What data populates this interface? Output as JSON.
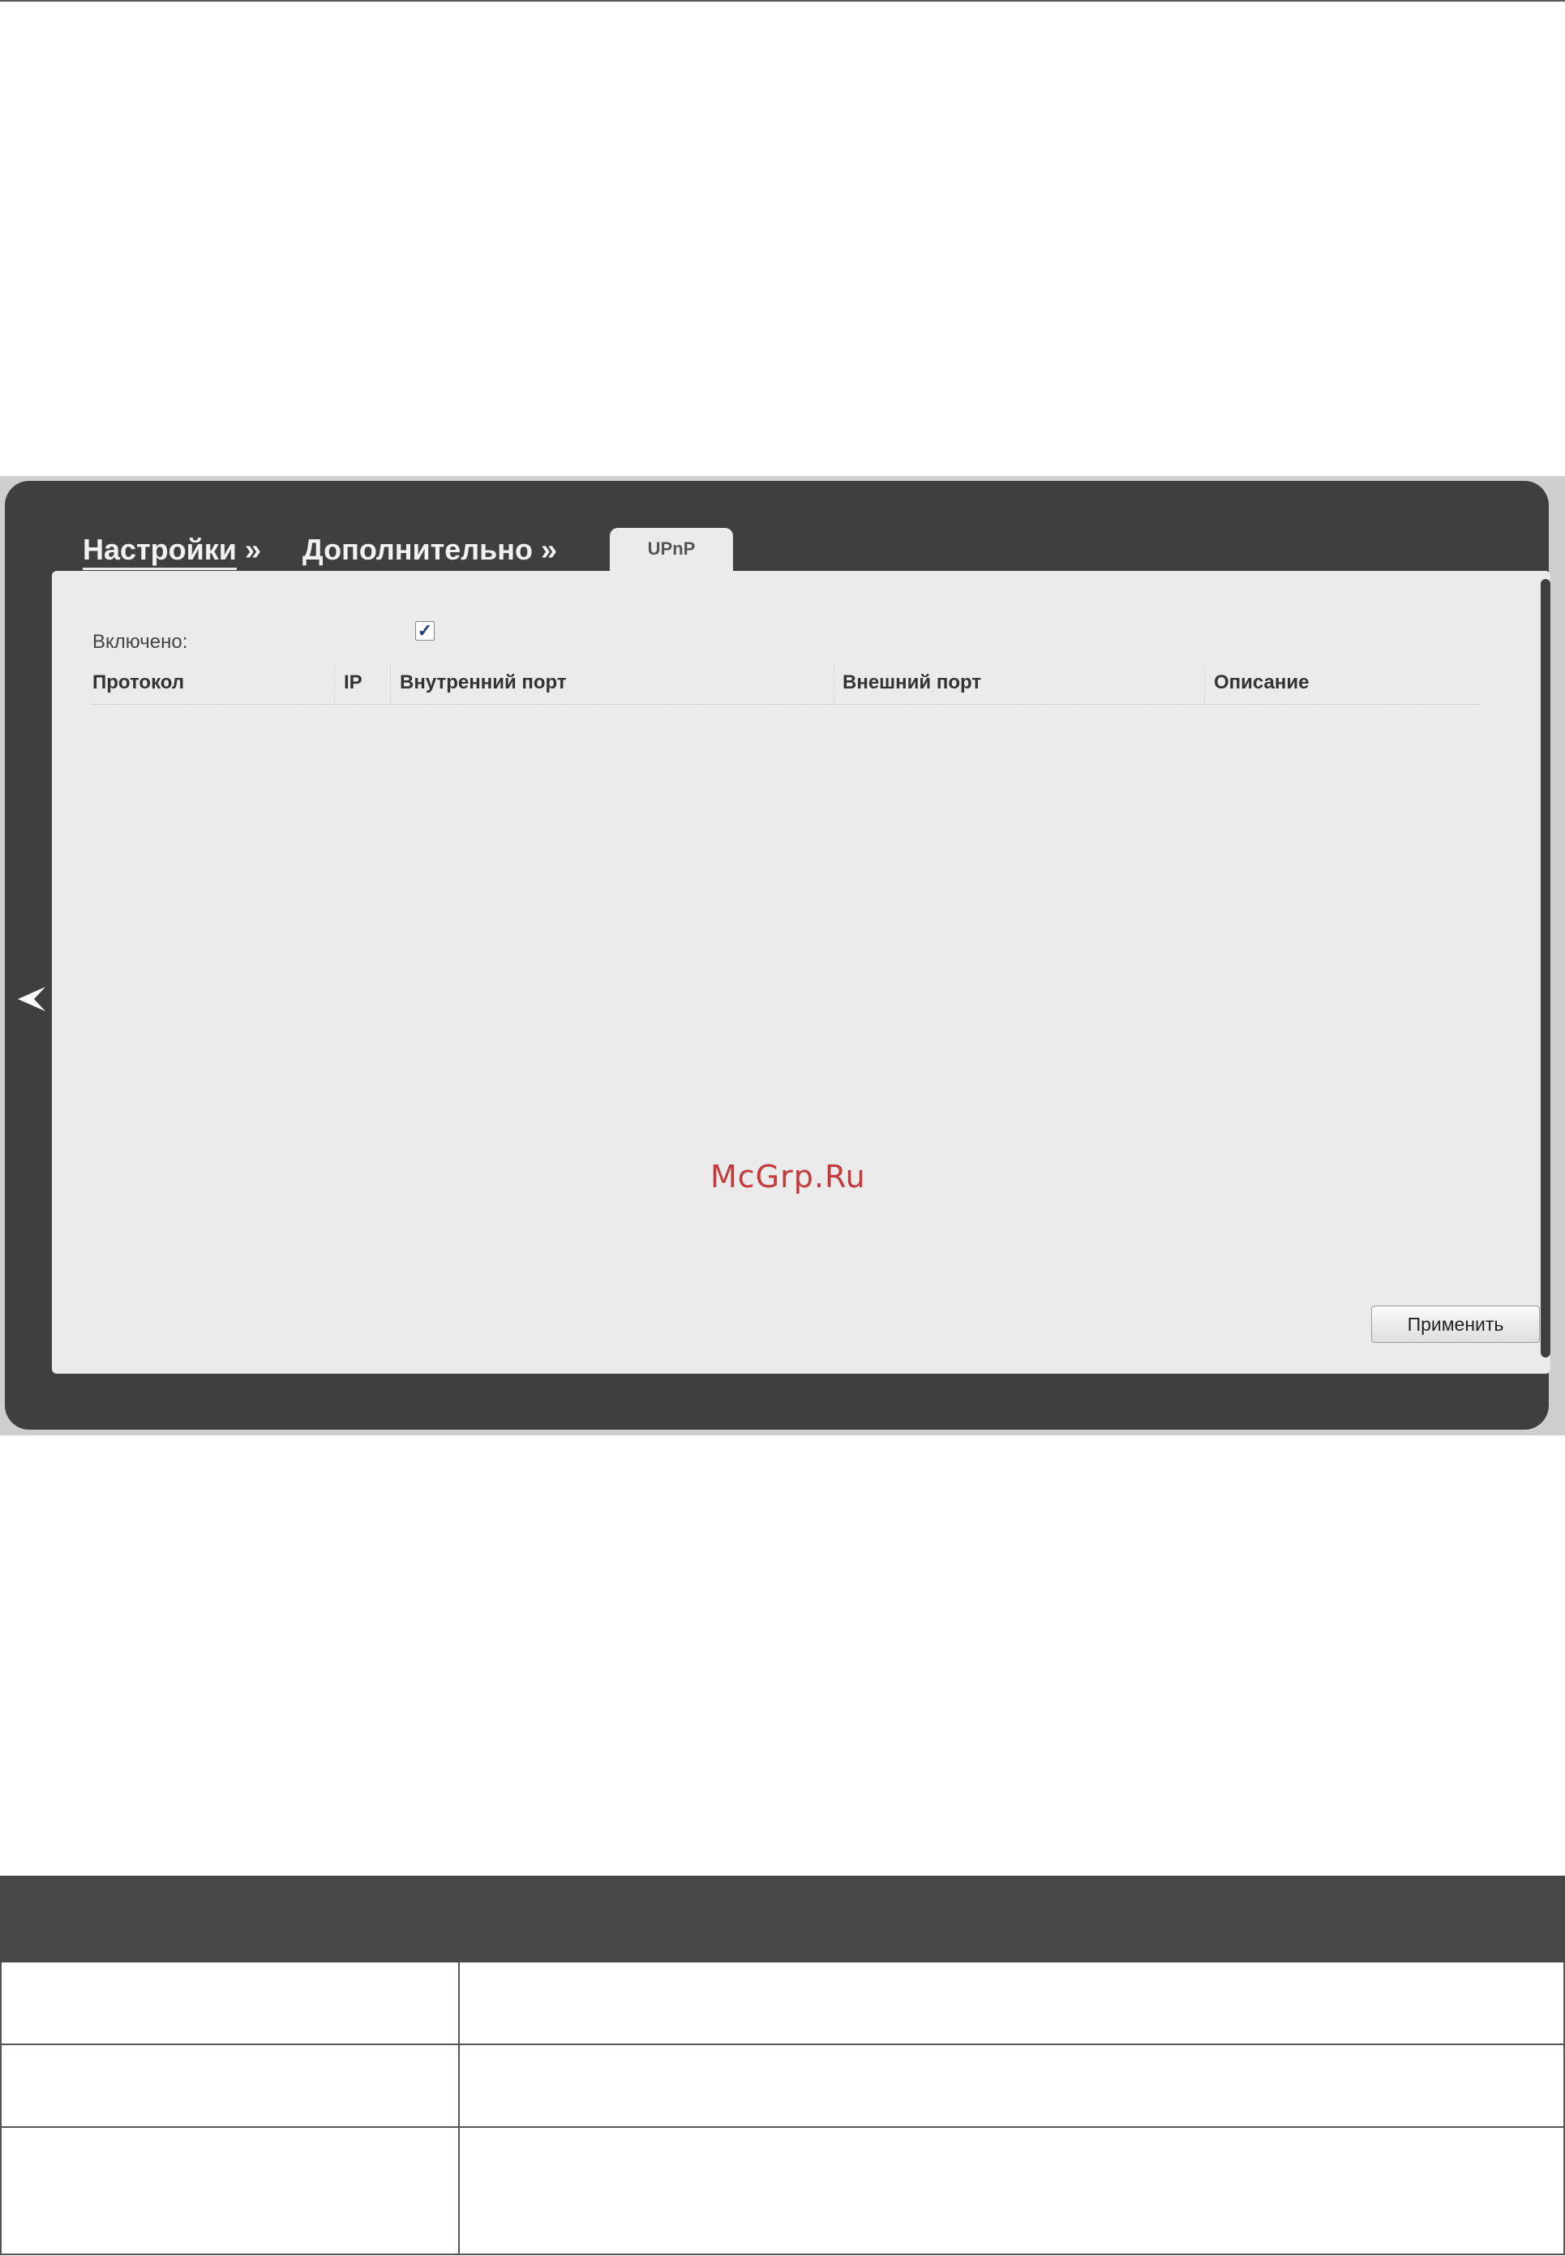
{
  "breadcrumb": {
    "settings": "Настройки",
    "additional": "Дополнительно",
    "separator": "»"
  },
  "tab": {
    "label": "UPnP"
  },
  "form": {
    "enabled_label": "Включено:",
    "enabled_checked": true,
    "checkmark": "✓"
  },
  "table": {
    "columns": [
      "Протокол",
      "IP",
      "Внутренний порт",
      "Внешний порт",
      "Описание"
    ]
  },
  "watermark": "McGrp.Ru",
  "apply_button": "Применить",
  "colors": {
    "shell": "#3f3f3f",
    "panel": "#ebebeb",
    "table_header": "#474747"
  }
}
